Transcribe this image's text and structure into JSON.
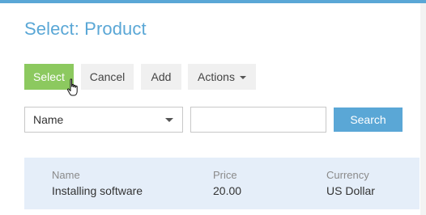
{
  "dialog": {
    "title": "Select: Product"
  },
  "toolbar": {
    "select_label": "Select",
    "cancel_label": "Cancel",
    "add_label": "Add",
    "actions_label": "Actions"
  },
  "filter": {
    "field_selected": "Name",
    "search_value": "",
    "search_label": "Search"
  },
  "results": {
    "rows": [
      {
        "name_caption": "Name",
        "name": "Installing software",
        "price_caption": "Price",
        "price": "20.00",
        "currency_caption": "Currency",
        "currency": "US Dollar"
      }
    ]
  },
  "colors": {
    "accent": "#5aa7d6",
    "select_button": "#8cc95f",
    "row_highlight": "#e5eef9"
  }
}
